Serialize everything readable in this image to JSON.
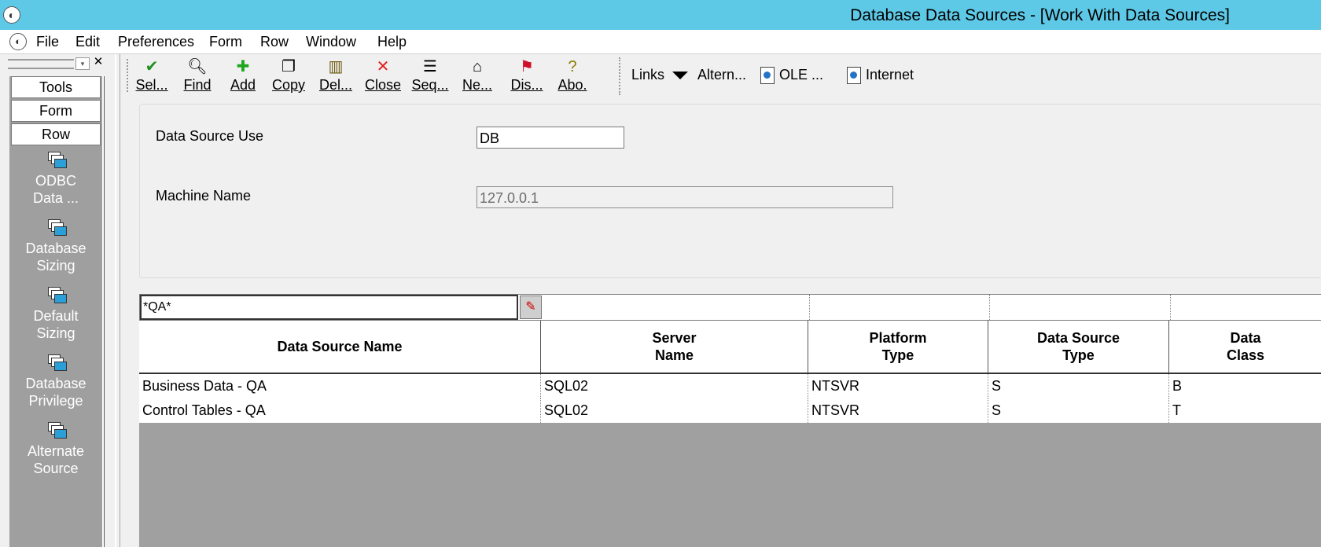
{
  "window": {
    "title": "Database Data Sources - [Work With Data Sources]"
  },
  "menubar": {
    "items": [
      "File",
      "Edit",
      "Preferences",
      "Form",
      "Row",
      "Window",
      "Help"
    ]
  },
  "sidebar": {
    "buttons": [
      "Tools",
      "Form",
      "Row"
    ],
    "items": [
      {
        "label_line1": "ODBC",
        "label_line2": "Data ..."
      },
      {
        "label_line1": "Database",
        "label_line2": "Sizing"
      },
      {
        "label_line1": "Default",
        "label_line2": "Sizing"
      },
      {
        "label_line1": "Database",
        "label_line2": "Privilege"
      },
      {
        "label_line1": "Alternate",
        "label_line2": "Source"
      }
    ]
  },
  "toolbar": {
    "buttons": [
      {
        "label": "Sel...",
        "icon": "checkmark-icon",
        "color": "#1f8f1f"
      },
      {
        "label": "Find",
        "icon": "find-icon"
      },
      {
        "label": "Add",
        "icon": "plus-icon",
        "color": "#1fa51f"
      },
      {
        "label": "Copy",
        "icon": "copy-icon"
      },
      {
        "label": "Del...",
        "icon": "trash-icon"
      },
      {
        "label": "Close",
        "icon": "close-icon",
        "color": "#e02020"
      },
      {
        "label": "Seq...",
        "icon": "sequence-icon"
      },
      {
        "label": "Ne...",
        "icon": "new-icon"
      },
      {
        "label": "Dis...",
        "icon": "display-icon"
      },
      {
        "label": "Abo.",
        "icon": "about-icon"
      }
    ],
    "links_label": "Links",
    "altern_label": "Altern...",
    "ole_label": "OLE ...",
    "internet_label": "Internet"
  },
  "form": {
    "data_source_use_label": "Data Source Use",
    "data_source_use_value": "DB",
    "machine_name_label": "Machine Name",
    "machine_name_value": "127.0.0.1"
  },
  "grid": {
    "qbe_value": "*QA*",
    "columns": [
      {
        "line1": "Data Source Name",
        "line2": ""
      },
      {
        "line1": "Server",
        "line2": "Name"
      },
      {
        "line1": "Platform",
        "line2": "Type"
      },
      {
        "line1": "Data Source",
        "line2": "Type"
      },
      {
        "line1": "Data",
        "line2": "Class"
      }
    ],
    "rows": [
      [
        "Business Data - QA",
        "SQL02",
        "NTSVR",
        "S",
        "B"
      ],
      [
        "Control Tables - QA",
        "SQL02",
        "NTSVR",
        "S",
        "T"
      ]
    ]
  }
}
